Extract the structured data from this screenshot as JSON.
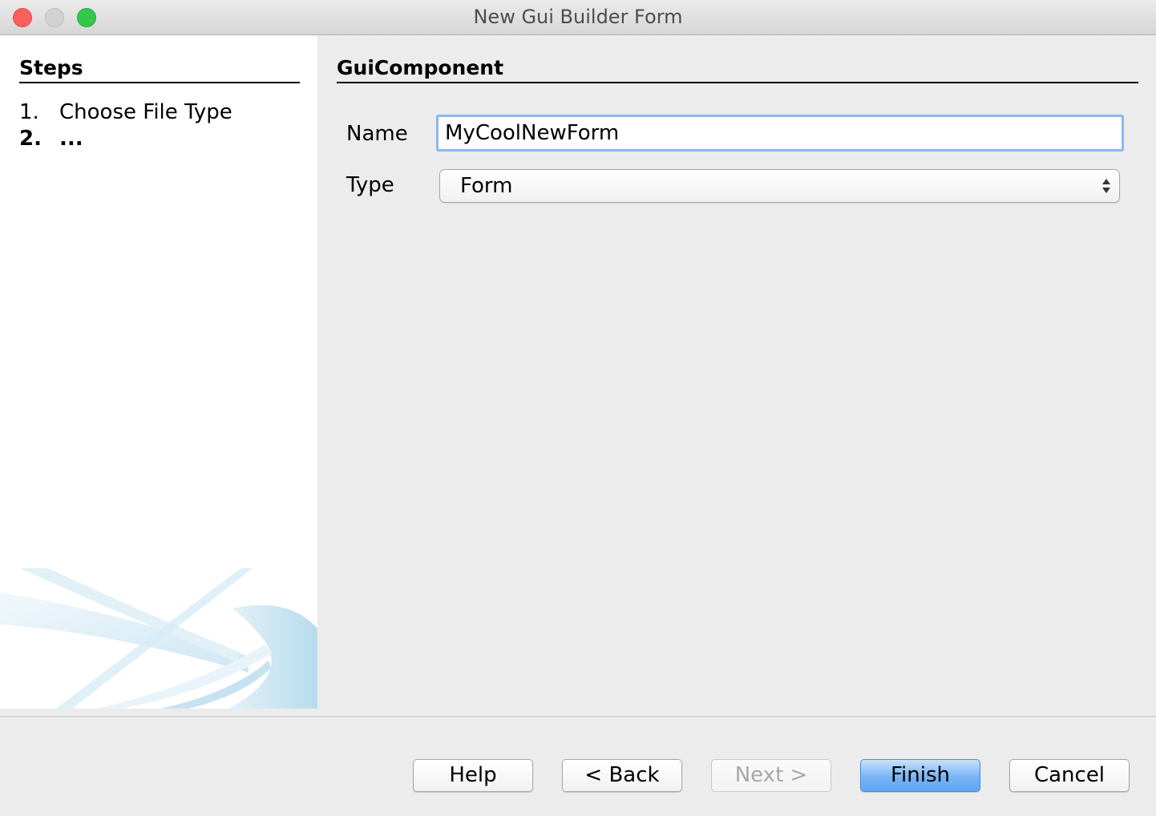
{
  "window": {
    "title": "New Gui Builder Form"
  },
  "steps": {
    "heading": "Steps",
    "items": [
      {
        "number": "1.",
        "label": "Choose File Type"
      },
      {
        "number": "2.",
        "label": "..."
      }
    ]
  },
  "form": {
    "heading": "GuiComponent",
    "name_label": "Name",
    "name_value": "MyCoolNewForm",
    "type_label": "Type",
    "type_value": "Form"
  },
  "buttons": {
    "help": "Help",
    "back": "< Back",
    "next": "Next >",
    "finish": "Finish",
    "cancel": "Cancel"
  },
  "colors": {
    "accent": "#5fa5f2",
    "focus_ring": "#8ab8ec",
    "close": "#fc605c",
    "maximize": "#34c84a"
  }
}
